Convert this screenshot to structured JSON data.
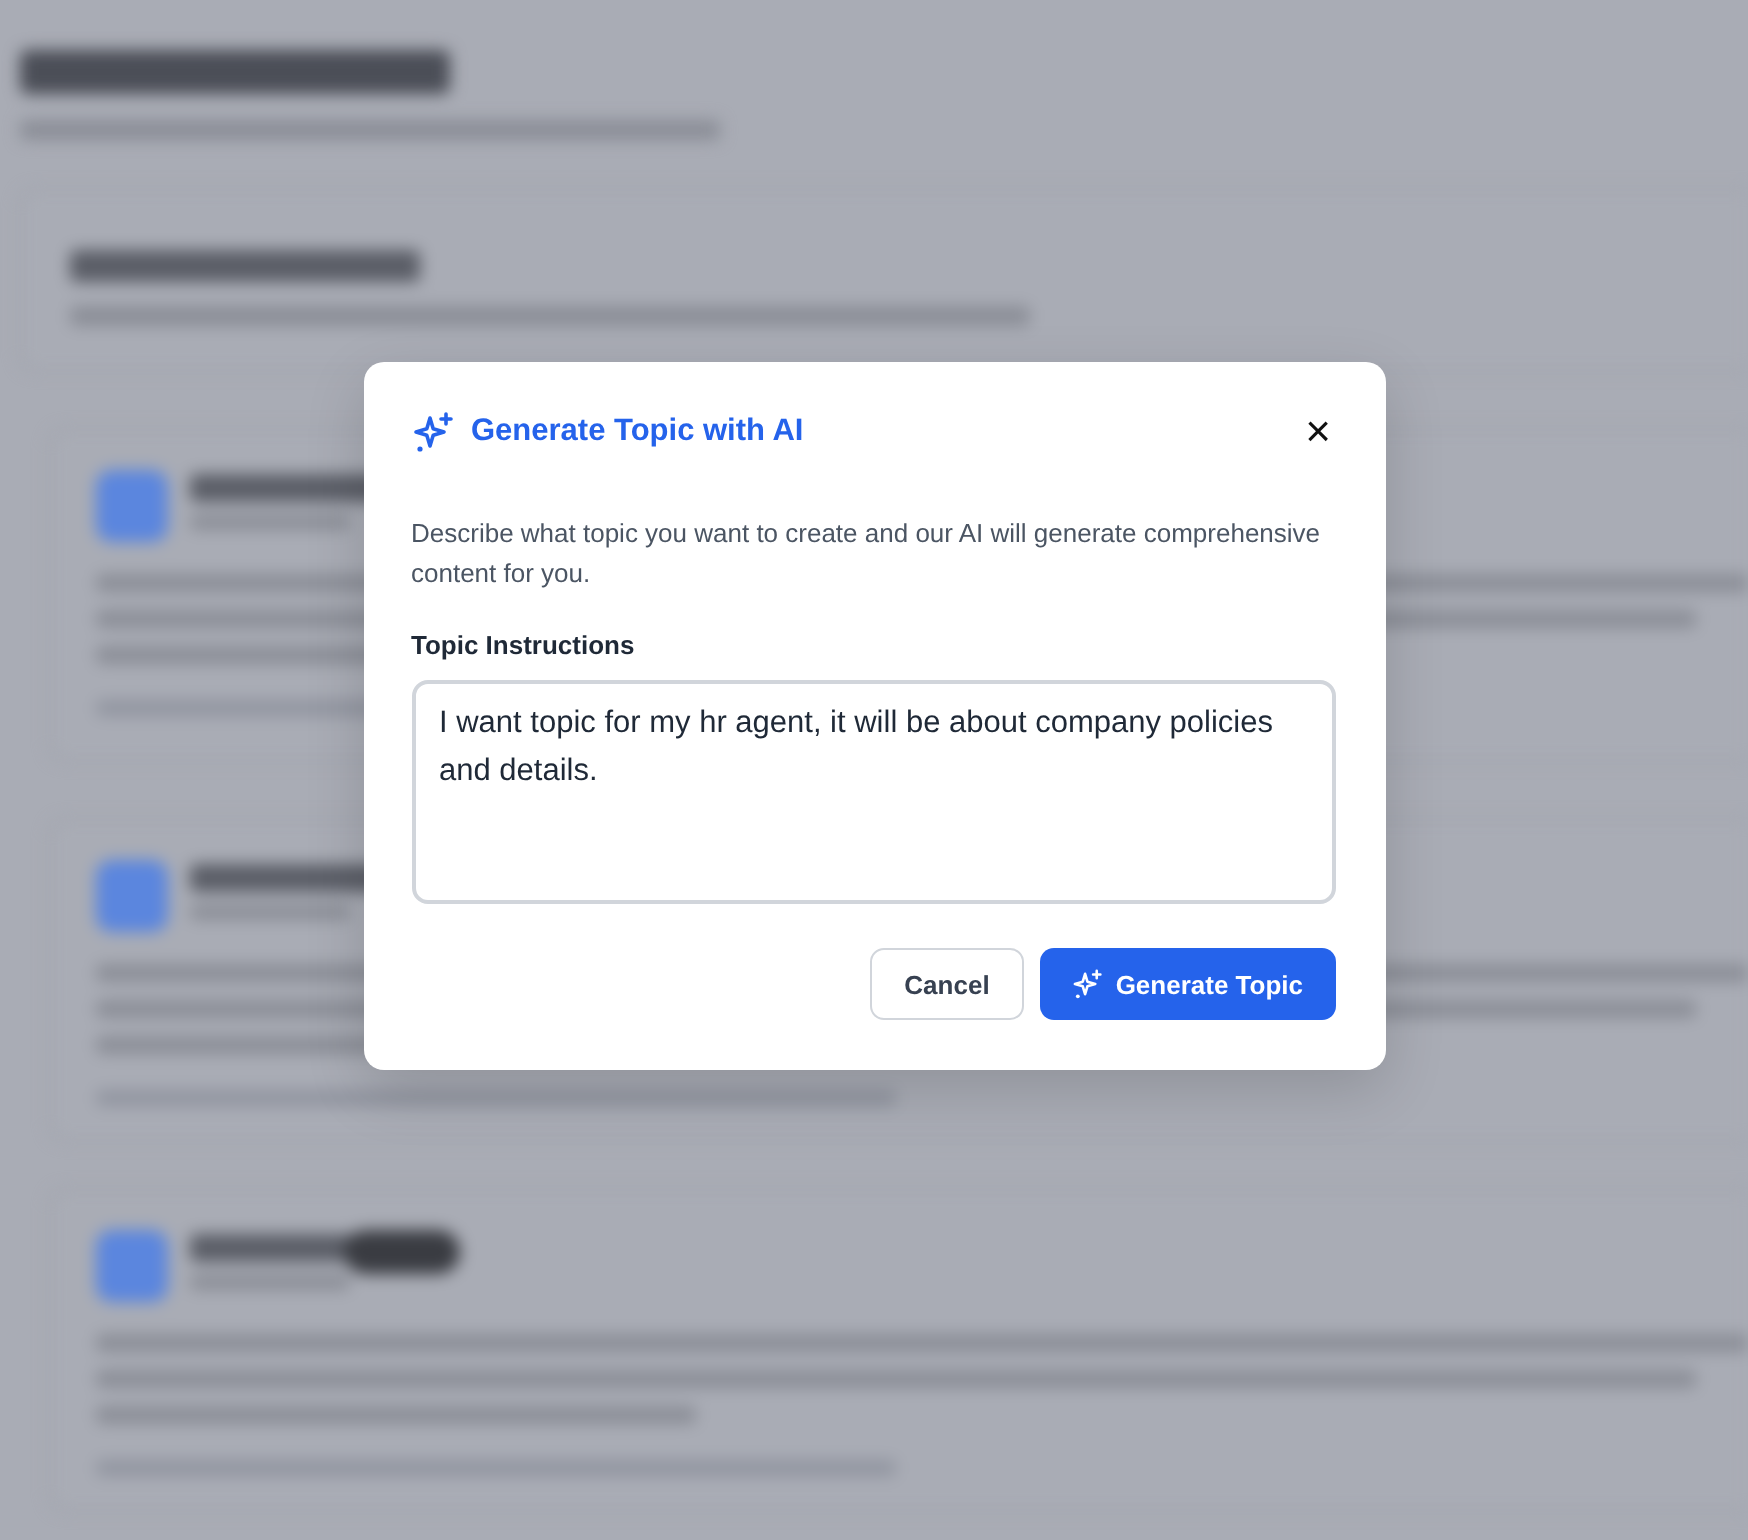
{
  "dialog": {
    "title": "Generate Topic with AI",
    "close": "×",
    "description": "Describe what topic you want to create and our AI will generate comprehensive content for you.",
    "field": {
      "label": "Topic Instructions",
      "value": "I want topic for my hr agent, it will be about company policies and details."
    },
    "buttons": [
      {
        "label": "Cancel",
        "kind": "secondary"
      },
      {
        "label": "Generate Topic",
        "kind": "primary"
      }
    ]
  }
}
